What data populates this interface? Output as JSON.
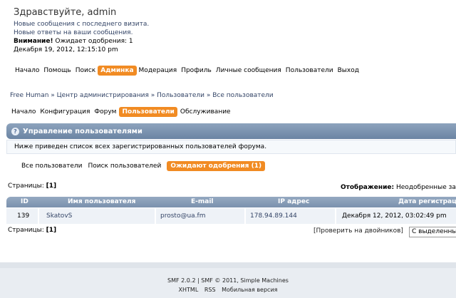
{
  "user": {
    "greeting": "Здравствуйте, admin",
    "new_messages": "Новые сообщения с последнего визита.",
    "new_replies": "Новые ответы на ваши сообщения.",
    "attention_label": "Внимание!",
    "attention_text": " Ожидает одобрения: 1",
    "datetime": "Декабря 19, 2012, 12:15:10 pm"
  },
  "main_nav": [
    "Начало",
    "Помощь",
    "Поиск",
    "Админка",
    "Модерация",
    "Профиль",
    "Личные сообщения",
    "Пользователи",
    "Выход"
  ],
  "main_nav_active": "Админка",
  "breadcrumb": "Free Human » Центр администрирования » Пользователи » Все пользователи",
  "sub_nav": [
    "Начало",
    "Конфигурация",
    "Форум",
    "Пользователи",
    "Обслуживание"
  ],
  "sub_nav_active": "Пользователи",
  "section": {
    "title": "Управление пользователями",
    "description": "Ниже приведен список всех зарегистрированных пользователей форума."
  },
  "tabs": [
    "Все пользователи",
    "Поиск пользователей",
    "Ожидают одобрения (1)"
  ],
  "tabs_active": "Ожидают одобрения (1)",
  "pages_label": "Страницы: ",
  "pages_current": "[1]",
  "show_label": "Отображение:",
  "show_value": " Неодобренные запро",
  "table": {
    "headers": [
      "ID",
      "Имя пользователя",
      "E-mail",
      "IP адрес",
      "Дата регистрации"
    ],
    "rows": [
      [
        "139",
        "SkatovS",
        "prosto@ua.fm",
        "178.94.89.144",
        "Декабря 12, 2012, 03:02:49 pm"
      ]
    ]
  },
  "check_duplicates": "[Проверить на двойников]",
  "selected_action": "С выделенны",
  "footer": {
    "smf": "SMF 2.0.2 | SMF © 2011, Simple Machines",
    "links": [
      "XHTML",
      "RSS",
      "Мобильная версия"
    ]
  },
  "colors": {
    "accent": "#f18b23",
    "header": "#7a91ad"
  }
}
